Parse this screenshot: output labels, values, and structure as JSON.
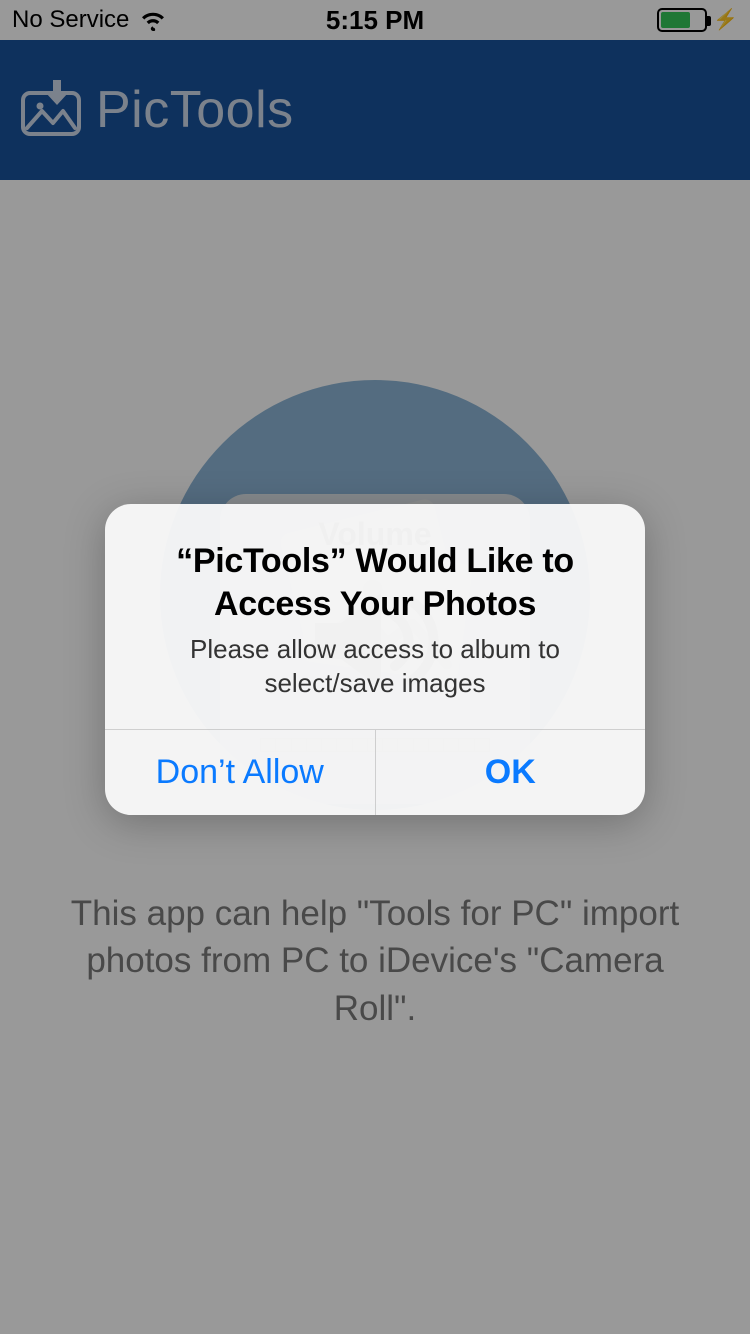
{
  "status": {
    "carrier": "No Service",
    "time": "5:15 PM"
  },
  "header": {
    "app_name": "PicTools"
  },
  "main": {
    "description": "This app can help \"Tools for PC\" import photos from PC to iDevice's \"Camera Roll\"."
  },
  "volume_hud": {
    "title": "Volume"
  },
  "alert": {
    "title": "“PicTools” Would Like to Access Your Photos",
    "message": "Please allow access to album to select/save images",
    "deny_label": "Don’t Allow",
    "allow_label": "OK"
  }
}
